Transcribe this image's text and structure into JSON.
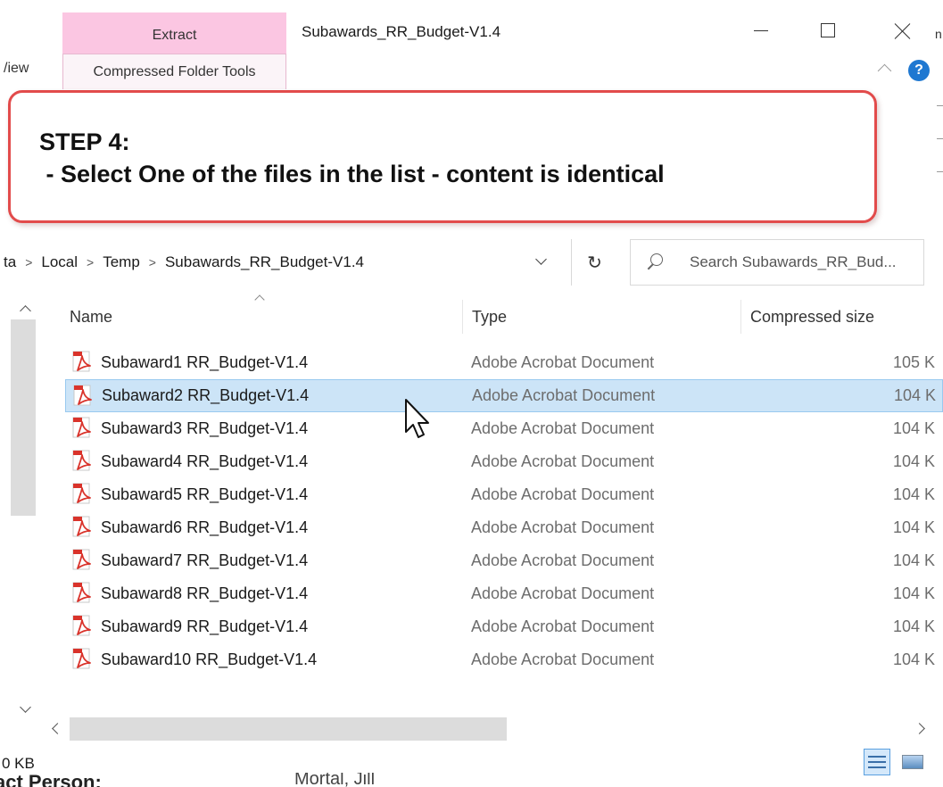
{
  "window": {
    "title": "Subawards_RR_Budget-V1.4",
    "ribbon": {
      "extract_tab": "Extract",
      "view_tab": "/iew",
      "tools_tab": "Compressed Folder Tools"
    },
    "help_label": "?",
    "edge_char": "n"
  },
  "callout": {
    "title": "STEP 4:",
    "text": " - Select One of the files in the list - content is identical",
    "border_color": "#e24b4b"
  },
  "address": {
    "crumbs": [
      "ta",
      "Local",
      "Temp",
      "Subawards_RR_Budget-V1.4"
    ],
    "separator": ">",
    "refresh_glyph": "↻"
  },
  "search": {
    "placeholder": "Search Subawards_RR_Bud..."
  },
  "columns": {
    "name": "Name",
    "type": "Type",
    "size": "Compressed size"
  },
  "files": [
    {
      "name": "Subaward1 RR_Budget-V1.4",
      "type": "Adobe Acrobat Document",
      "size": "105 K",
      "selected": false
    },
    {
      "name": "Subaward2 RR_Budget-V1.4",
      "type": "Adobe Acrobat Document",
      "size": "104 K",
      "selected": true
    },
    {
      "name": "Subaward3 RR_Budget-V1.4",
      "type": "Adobe Acrobat Document",
      "size": "104 K",
      "selected": false
    },
    {
      "name": "Subaward4 RR_Budget-V1.4",
      "type": "Adobe Acrobat Document",
      "size": "104 K",
      "selected": false
    },
    {
      "name": "Subaward5 RR_Budget-V1.4",
      "type": "Adobe Acrobat Document",
      "size": "104 K",
      "selected": false
    },
    {
      "name": "Subaward6 RR_Budget-V1.4",
      "type": "Adobe Acrobat Document",
      "size": "104 K",
      "selected": false
    },
    {
      "name": "Subaward7 RR_Budget-V1.4",
      "type": "Adobe Acrobat Document",
      "size": "104 K",
      "selected": false
    },
    {
      "name": "Subaward8 RR_Budget-V1.4",
      "type": "Adobe Acrobat Document",
      "size": "104 K",
      "selected": false
    },
    {
      "name": "Subaward9 RR_Budget-V1.4",
      "type": "Adobe Acrobat Document",
      "size": "104 K",
      "selected": false
    },
    {
      "name": "Subaward10 RR_Budget-V1.4",
      "type": "Adobe Acrobat Document",
      "size": "104 K",
      "selected": false
    }
  ],
  "status": {
    "size_text": "0 KB"
  },
  "background_doc": {
    "left_text": "act Person:",
    "right_text": "Mortal, Jill"
  },
  "colors": {
    "ribbon_pink": "#fbc6e2",
    "selection": "#cce4f7",
    "help_blue": "#1f78d1",
    "pdf_red": "#d9332b"
  },
  "icons": {
    "file": "pdf-file-icon",
    "cursor": "mouse-pointer-icon"
  }
}
